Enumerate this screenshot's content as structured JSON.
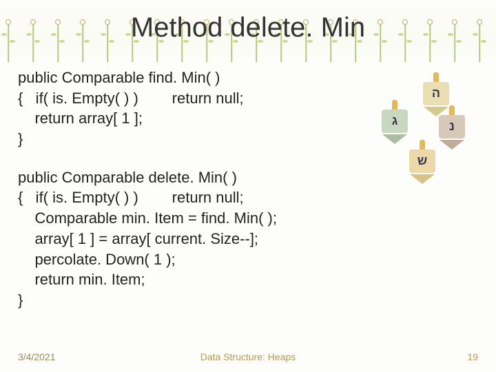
{
  "title": "Method delete. Min",
  "code": {
    "block1": {
      "l1": "public Comparable find. Min( )",
      "l2": "{   if( is. Empty( ) )        return null;",
      "l3": "    return array[ 1 ];",
      "l4": "}"
    },
    "block2": {
      "l1": "public Comparable delete. Min( )",
      "l2": "{   if( is. Empty( ) )        return null;",
      "l3": "    Comparable min. Item = find. Min( );",
      "l4": "    array[ 1 ] = array[ current. Size--];",
      "l5": "    percolate. Down( 1 );",
      "l6": "    return min. Item;",
      "l7": "}"
    }
  },
  "footer": {
    "date": "3/4/2021",
    "center": "Data Structure: Heaps",
    "page": "19"
  },
  "clipart": {
    "letters": {
      "d1": "ה",
      "d2": "ג",
      "d3": "נ",
      "d4": "ש"
    }
  }
}
